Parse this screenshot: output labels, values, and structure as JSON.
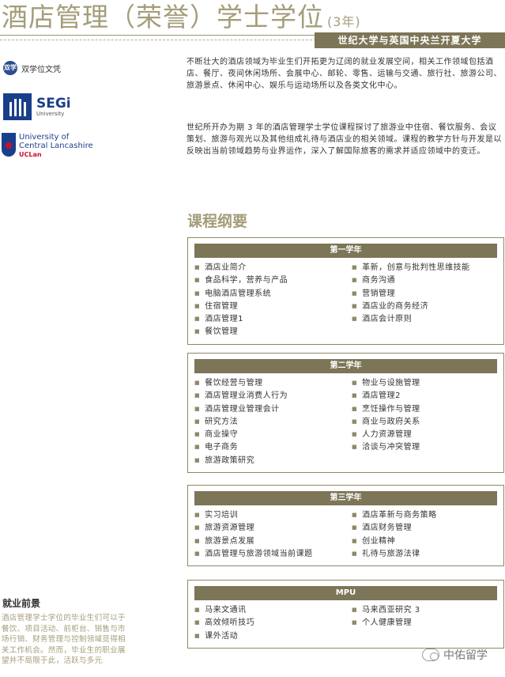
{
  "header": {
    "title": "酒店管理（荣誉）学士学位",
    "years": "(3年)",
    "banner": "世纪大学与英国中央兰开夏大学"
  },
  "logos": {
    "dual_badge": "双学位",
    "dual_label": "双学位文凭",
    "segi_name": "SEGi",
    "segi_sub": "University",
    "uclan_line1": "University of",
    "uclan_line2": "Central Lancashire",
    "uclan_short": "UCLan"
  },
  "intro": {
    "p1": "不断壮大的酒店领域为毕业生们开拓更为辽阔的就业发展空间，相关工作领域包括酒店、餐厅、夜间休闲场所、会展中心、邮轮、零售、运输与交通、旅行社、旅游公司、旅游景点、休闲中心、娱乐与运动场所以及各类文化中心。",
    "p2": "世纪所开办为期 3 年的酒店管理学士学位课程探讨了旅游业中住宿、餐饮服务、会议策划、旅游与观光以及其他组成礼待与酒店业的相关领域。课程的教学方针与开发是以反映出当前领域趋势与业界运作，深入了解国际旅客的需求并适应领域中的变迁。"
  },
  "syllabus": {
    "heading": "课程纲要",
    "boxes": [
      {
        "title": "第一学年",
        "left": [
          "酒店业简介",
          "食品科学，营养与产品",
          "电脑酒店管理系统",
          "住宿管理",
          "酒店管理1",
          "餐饮管理"
        ],
        "right": [
          "革新，创意与批判性思维技能",
          "商务沟通",
          "营销管理",
          "酒店业的商务经济",
          "酒店会计原则"
        ]
      },
      {
        "title": "第二学年",
        "left": [
          "餐饮经营与管理",
          "酒店管理业消费人行为",
          "酒店管理业管理会计",
          "研究方法",
          "商业操守",
          "电子商务",
          "旅游政策研究"
        ],
        "right": [
          "物业与设施管理",
          "酒店管理2",
          "烹饪操作与管理",
          "商业与政府关系",
          "人力资源管理",
          "洽谈与冲突管理"
        ]
      },
      {
        "title": "第三学年",
        "left": [
          "实习培训",
          "旅游资源管理",
          "旅游景点发展",
          "酒店管理与旅游领域当前课题"
        ],
        "right": [
          "酒店革新与商务策略",
          "酒店财务管理",
          "创业精神",
          "礼待与旅游法律"
        ]
      },
      {
        "title": "MPU",
        "left": [
          "马来文通讯",
          "高效倾听技巧",
          "课外活动"
        ],
        "right": [
          "马来西亚研究 3",
          "个人健康管理"
        ]
      }
    ]
  },
  "career": {
    "title": "就业前景",
    "text": "酒店管理学士学位的毕业生们可以于餐饮、项目活动、前柜台、销售与市场行销、财务管理与控制领域觅得相关工作机会。然而，毕业生的职业展望并不局限于此，活跃与多元"
  },
  "watermark": {
    "text": "中佑留学"
  }
}
